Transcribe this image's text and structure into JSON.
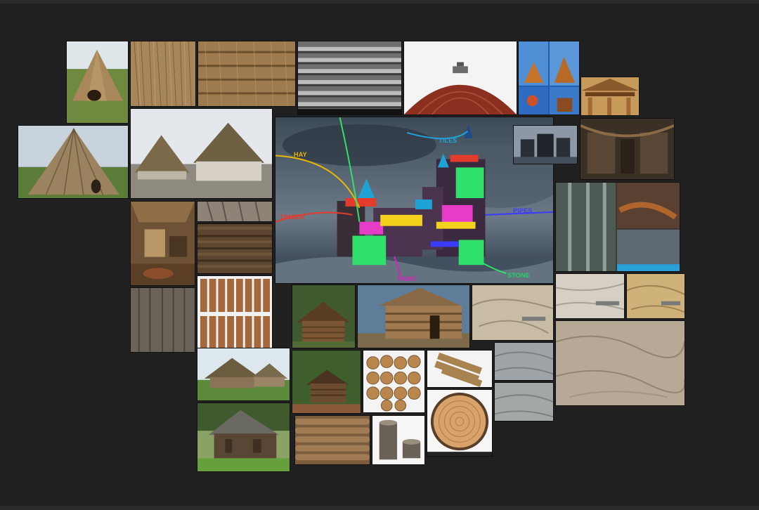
{
  "board": {
    "annotations": {
      "hay": "HAY",
      "tiles": "TILES",
      "timber": "TIMBER",
      "pipes": "PIPES",
      "paint": "PAINT",
      "stone": "STONE"
    },
    "colors": {
      "background": "#202020",
      "hay": "#e8b900",
      "tiles": "#1fa3d6",
      "timber": "#e33b2c",
      "pipes": "#3b3bff",
      "paint": "#e01fc0",
      "stone": "#1fd36a"
    }
  },
  "tiles": [
    {
      "icon": "thatched-hut-photo"
    },
    {
      "icon": "straw-texture"
    },
    {
      "icon": "thatch-texture"
    },
    {
      "icon": "shingle-texture"
    },
    {
      "icon": "red-dome-roof-photo"
    },
    {
      "icon": "wooden-church-collage"
    },
    {
      "icon": "ornate-wooden-gable-photo"
    },
    {
      "icon": "conical-hut-photo"
    },
    {
      "icon": "round-thatched-houses-photo"
    },
    {
      "icon": "fantasy-castle-concept"
    },
    {
      "icon": "dark-castle-sketch"
    },
    {
      "icon": "industrial-interior-photo"
    },
    {
      "icon": "log-cabin-interior-photo"
    },
    {
      "icon": "weathered-planks-texture"
    },
    {
      "icon": "dark-planks-texture"
    },
    {
      "icon": "vertical-boards-texture"
    },
    {
      "icon": "plank-set-texture"
    },
    {
      "icon": "industrial-pipes-collage"
    },
    {
      "icon": "log-cabin-forest-photo"
    },
    {
      "icon": "log-cabin-building-photo"
    },
    {
      "icon": "stone-texture-a"
    },
    {
      "icon": "stone-texture-b"
    },
    {
      "icon": "stone-texture-c"
    },
    {
      "icon": "stone-texture-large"
    },
    {
      "icon": "stone-texture-d"
    },
    {
      "icon": "stone-texture-e"
    },
    {
      "icon": "thatched-cottages-photo"
    },
    {
      "icon": "log-cabin-hill-photo"
    },
    {
      "icon": "log-pile-photo"
    },
    {
      "icon": "three-logs-photo"
    },
    {
      "icon": "old-barn-photo"
    },
    {
      "icon": "log-wall-texture"
    },
    {
      "icon": "stumps-photo"
    },
    {
      "icon": "tree-ring-cross-section"
    }
  ]
}
